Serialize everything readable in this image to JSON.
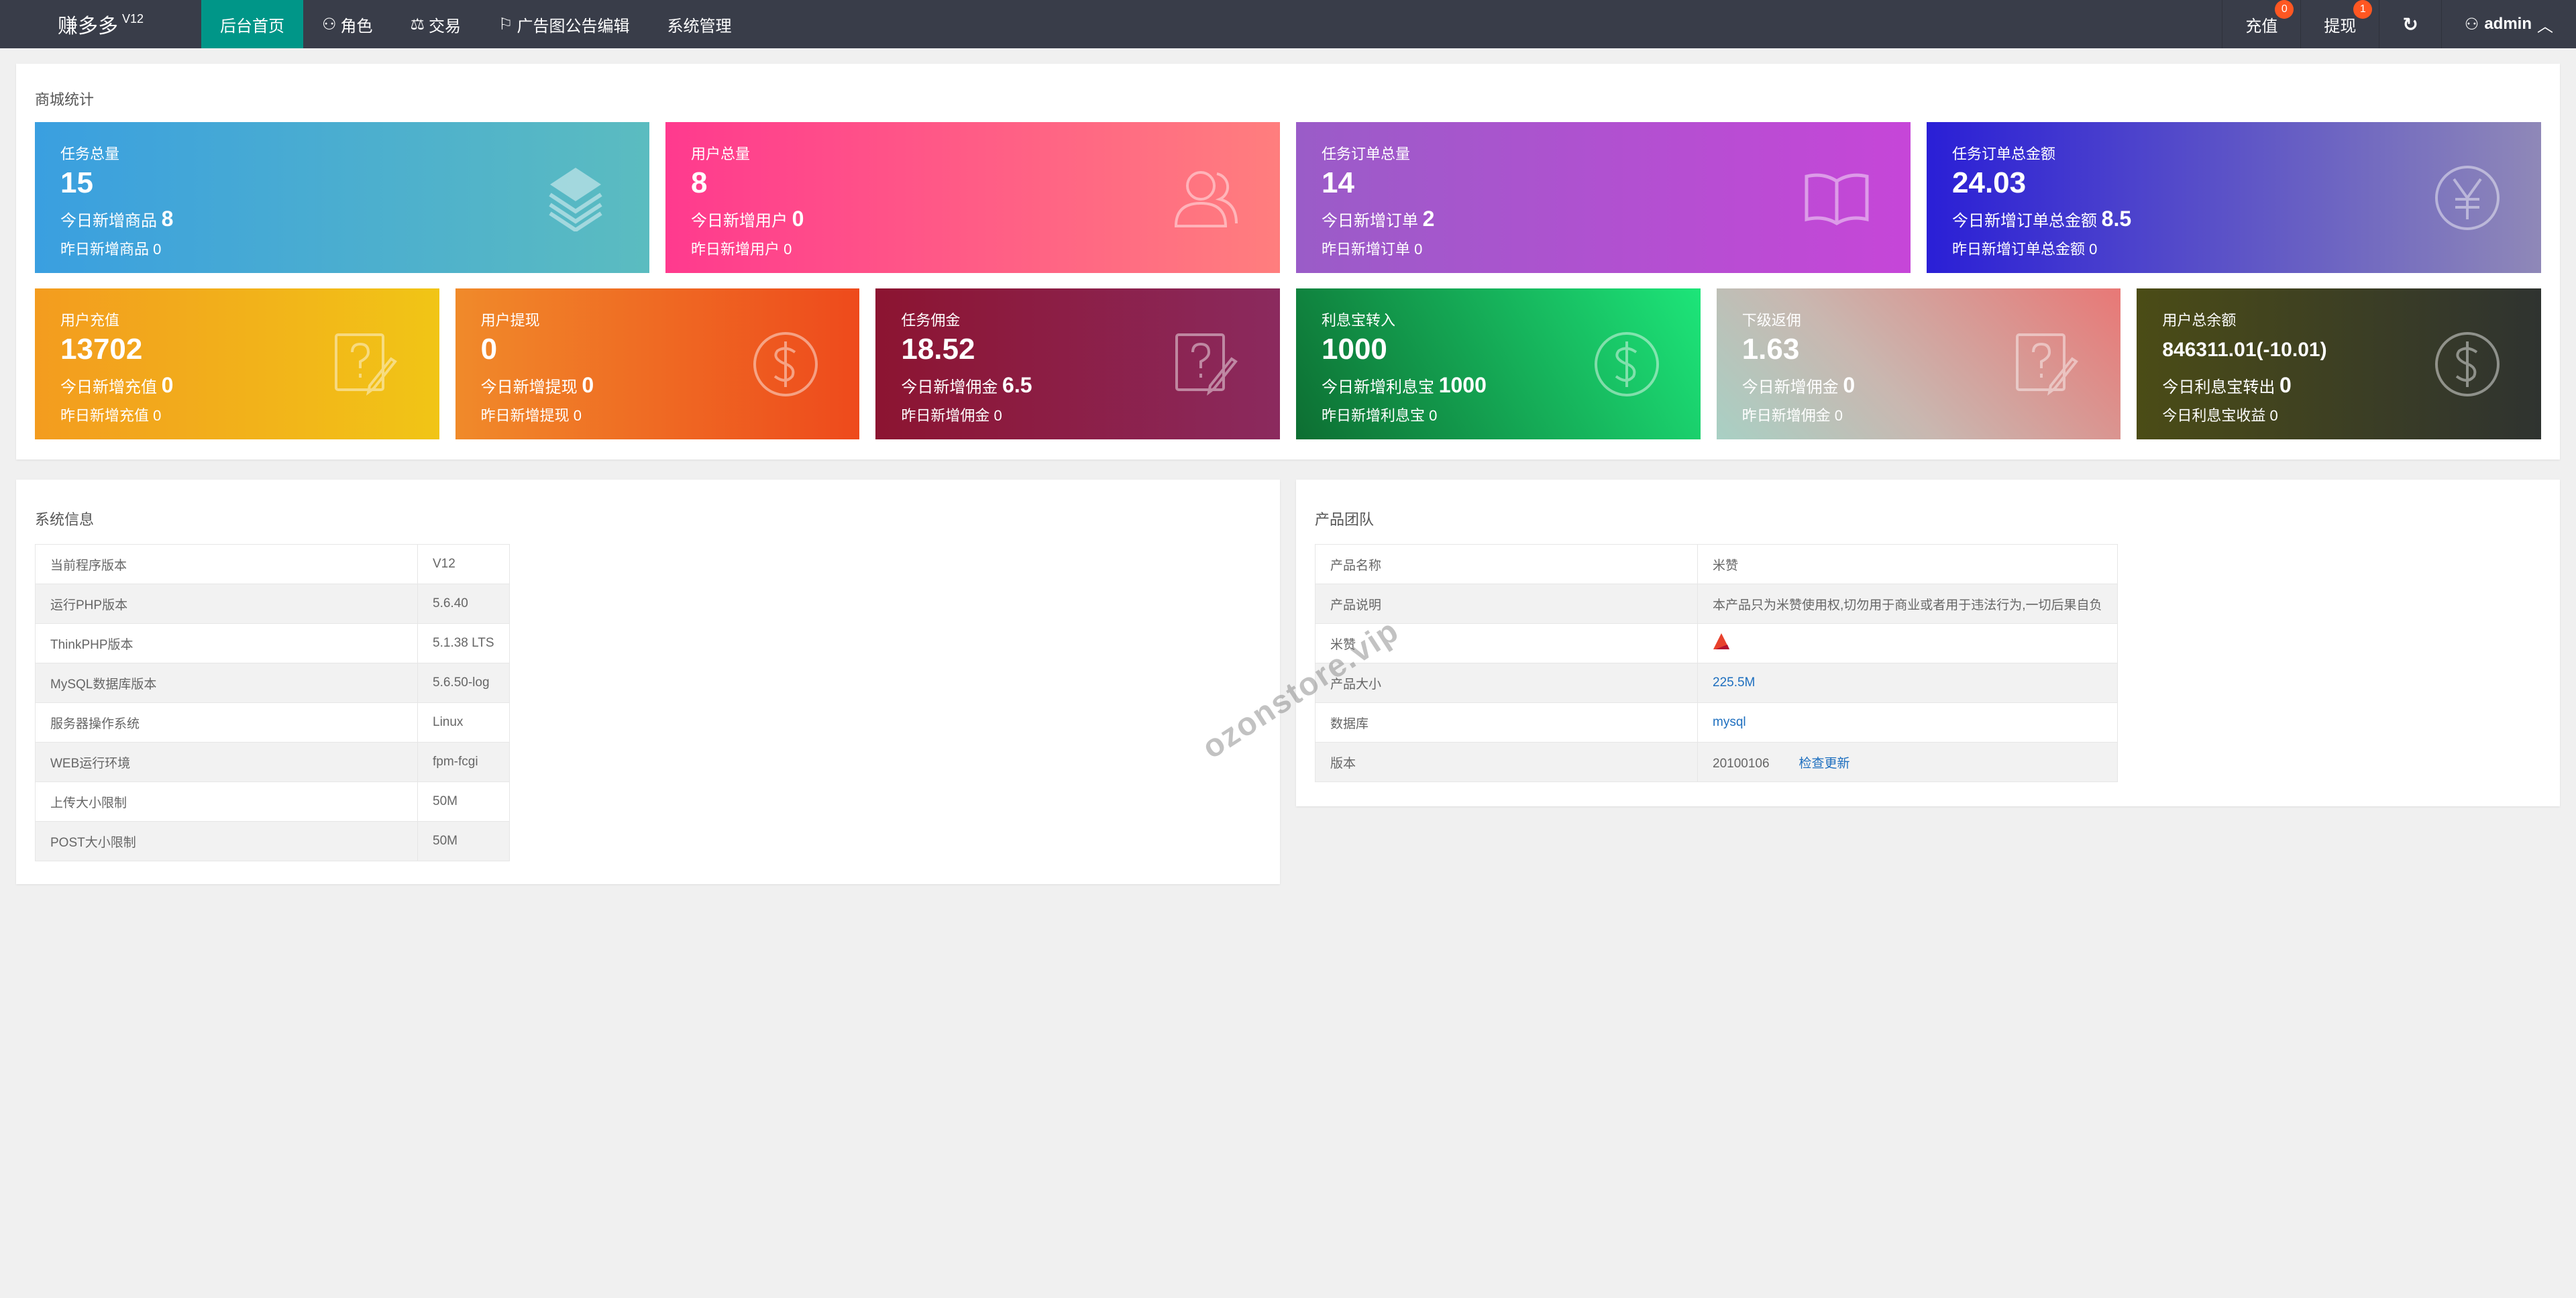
{
  "nav": {
    "logo": "赚多多",
    "version": "V12",
    "menu": [
      {
        "label": "后台首页",
        "icon": "home"
      },
      {
        "label": "角色",
        "icon": "user-icon"
      },
      {
        "label": "交易",
        "icon": "scale-icon"
      },
      {
        "label": "广告图公告编辑",
        "icon": "flag-icon"
      },
      {
        "label": "系统管理",
        "icon": ""
      }
    ],
    "recharge": "充值",
    "recharge_badge": "0",
    "withdraw": "提现",
    "withdraw_badge": "1",
    "user": "admin"
  },
  "stats": {
    "title": "商城统计",
    "row1": [
      {
        "title": "任务总量",
        "value": "15",
        "s1": "今日新增商品",
        "s1v": "8",
        "s2": "昨日新增商品 0",
        "icon": "layers-icon",
        "colors": [
          "#3a9fe0",
          "#5bbcc0"
        ]
      },
      {
        "title": "用户总量",
        "value": "8",
        "s1": "今日新增用户",
        "s1v": "0",
        "s2": "昨日新增用户 0",
        "icon": "users-icon",
        "colors": [
          "#ff3a8e",
          "#ff7e7e"
        ]
      },
      {
        "title": "任务订单总量",
        "value": "14",
        "s1": "今日新增订单",
        "s1v": "2",
        "s2": "昨日新增订单 0",
        "icon": "book-icon",
        "colors": [
          "#9a5cc8",
          "#c646d8"
        ]
      },
      {
        "title": "任务订单总金额",
        "value": "24.03",
        "s1": "今日新增订单总金额",
        "s1v": "8.5",
        "s2": "昨日新增订单总金额 0",
        "icon": "yen-icon",
        "colors": [
          "#2a1fd6",
          "#8f88b8"
        ]
      }
    ],
    "row2": [
      {
        "title": "用户充值",
        "value": "13702",
        "s1": "今日新增充值",
        "s1v": "0",
        "s2": "昨日新增充值 0",
        "icon": "question-edit-icon",
        "colors": [
          "#f39c1f",
          "#f1c516"
        ]
      },
      {
        "title": "用户提现",
        "value": "0",
        "s1": "今日新增提现",
        "s1v": "0",
        "s2": "昨日新增提现 0",
        "icon": "dollar-icon",
        "colors": [
          "#f08a2a",
          "#ee4a1c"
        ]
      },
      {
        "title": "任务佣金",
        "value": "18.52",
        "s1": "今日新增佣金",
        "s1v": "6.5",
        "s2": "昨日新增佣金 0",
        "icon": "question-edit-icon",
        "colors": [
          "#8c1431",
          "#8b2a5e"
        ]
      },
      {
        "title": "利息宝转入",
        "value": "1000",
        "s1": "今日新增利息宝",
        "s1v": "1000",
        "s2": "昨日新增利息宝 0",
        "icon": "dollar-icon",
        "colors": [
          "#0d6e32",
          "#1de579"
        ]
      },
      {
        "title": "下级返佣",
        "value": "1.63",
        "s1": "今日新增佣金",
        "s1v": "0",
        "s2": "昨日新增佣金 0",
        "icon": "question-edit-icon",
        "colors": [
          "#a8d0c4",
          "#e87876"
        ]
      },
      {
        "title": "用户总余额",
        "value": "846311.01(-10.01)",
        "s1": "今日利息宝转出",
        "s1v": "0",
        "s2": "今日利息宝收益 0",
        "icon": "dollar-icon",
        "colors": [
          "#4b4c16",
          "#2f3330"
        ]
      }
    ]
  },
  "sysinfo": {
    "title": "系统信息",
    "rows": [
      [
        "当前程序版本",
        "V12"
      ],
      [
        "运行PHP版本",
        "5.6.40"
      ],
      [
        "ThinkPHP版本",
        "5.1.38 LTS"
      ],
      [
        "MySQL数据库版本",
        "5.6.50-log"
      ],
      [
        "服务器操作系统",
        "Linux"
      ],
      [
        "WEB运行环境",
        "fpm-fcgi"
      ],
      [
        "上传大小限制",
        "50M"
      ],
      [
        "POST大小限制",
        "50M"
      ]
    ]
  },
  "team": {
    "title": "产品团队",
    "rows": [
      [
        "产品名称",
        "米赞"
      ],
      [
        "产品说明",
        "本产品只为米赞使用权,切勿用于商业或者用于违法行为,一切后果自负"
      ],
      [
        "米赞",
        ""
      ],
      [
        "产品大小",
        "225.5M"
      ],
      [
        "数据库",
        "mysql"
      ],
      [
        "版本",
        "20100106"
      ]
    ],
    "check_update": "检查更新"
  },
  "watermark": "ozonstore.vip"
}
